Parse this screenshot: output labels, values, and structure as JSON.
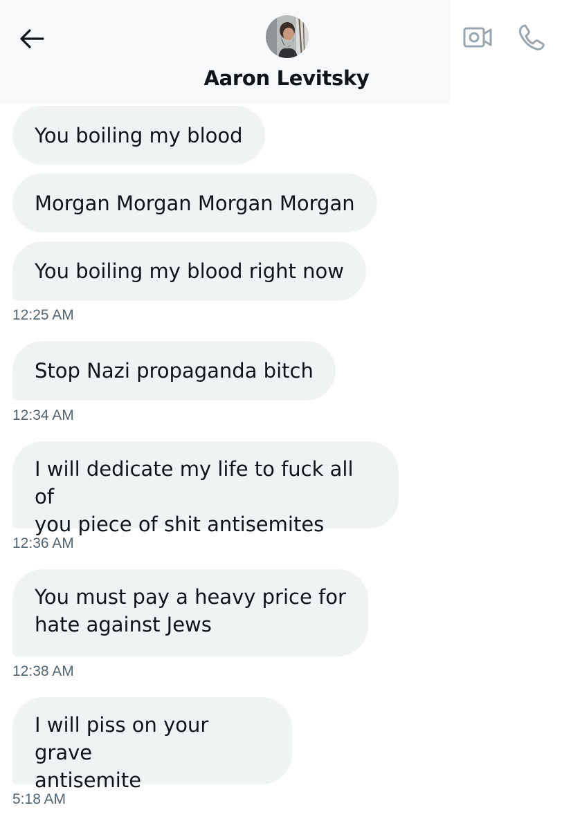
{
  "header": {
    "contact_name": "Aaron Levitsky",
    "back_icon": "arrow-left-icon",
    "video_icon": "video-call-icon",
    "call_icon": "phone-icon",
    "avatar_desc": "avatar"
  },
  "colors": {
    "bubble_bg": "#eff3f4",
    "text": "#0f1419",
    "timestamp": "#536471",
    "icon_muted": "#9aa5ad"
  },
  "messages": [
    {
      "text": "You boiling my blood"
    },
    {
      "text": "Morgan Morgan Morgan Morgan"
    },
    {
      "text": "You boiling my blood right now",
      "time": "12:25 AM"
    },
    {
      "text": "Stop Nazi propaganda bitch",
      "time": "12:34 AM"
    },
    {
      "text_lines": [
        "I will dedicate my life to fuck all of",
        "you piece of shit antisemites"
      ],
      "time": "12:36 AM"
    },
    {
      "text_lines": [
        "You must pay a heavy price for",
        "hate against Jews"
      ],
      "time": "12:38 AM"
    },
    {
      "text_lines": [
        "I will piss on your grave",
        "antisemite"
      ],
      "time": "5:18 AM"
    }
  ]
}
